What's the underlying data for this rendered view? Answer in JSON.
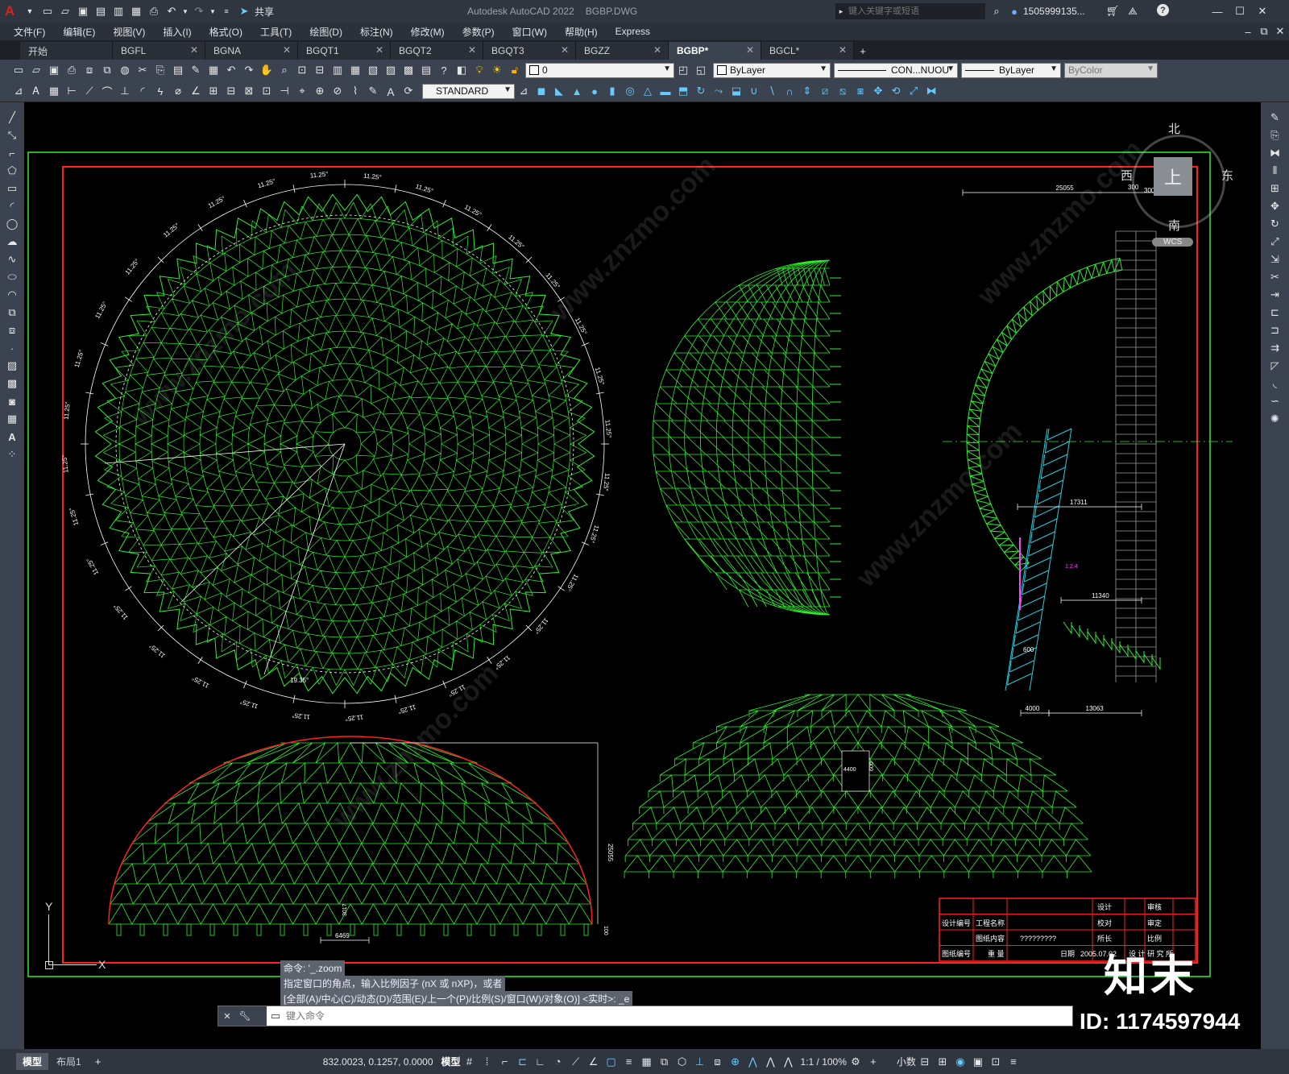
{
  "titlebar": {
    "app_title": "Autodesk AutoCAD 2022",
    "file_title": "BGBP.DWG",
    "share_label": "共享",
    "search_placeholder": "键入关键字或短语",
    "user_label": "1505999135...",
    "app_logo": "A"
  },
  "menu": [
    "文件(F)",
    "编辑(E)",
    "视图(V)",
    "插入(I)",
    "格式(O)",
    "工具(T)",
    "绘图(D)",
    "标注(N)",
    "修改(M)",
    "参数(P)",
    "窗口(W)",
    "帮助(H)",
    "Express"
  ],
  "tabs": [
    {
      "label": "开始",
      "closable": false,
      "active": false
    },
    {
      "label": "BGFL",
      "closable": true,
      "active": false
    },
    {
      "label": "BGNA",
      "closable": true,
      "active": false
    },
    {
      "label": "BGQT1",
      "closable": true,
      "active": false
    },
    {
      "label": "BGQT2",
      "closable": true,
      "active": false
    },
    {
      "label": "BGQT3",
      "closable": true,
      "active": false
    },
    {
      "label": "BGZZ",
      "closable": true,
      "active": false
    },
    {
      "label": "BGBP*",
      "closable": true,
      "active": true
    },
    {
      "label": "BGCL*",
      "closable": true,
      "active": false
    }
  ],
  "toolbar": {
    "layer_value": "0",
    "color_value": "ByLayer",
    "linetype_value": "CON...NUOU",
    "lineweight_value": "ByLayer",
    "plotstyle_value": "ByColor",
    "textstyle_value": "STANDARD"
  },
  "viewcube": {
    "north": "北",
    "south": "南",
    "east": "东",
    "west": "西",
    "face": "上",
    "wcs": "WCS"
  },
  "drawing": {
    "angle_label": "11.25°",
    "special_angle": "19.35°",
    "dims": {
      "plan_width": "25055",
      "plan_small1": "300",
      "plan_small2": "3000",
      "span_a": "17311",
      "span_b": "11340",
      "span_c": "4000",
      "span_d": "13063",
      "small_600": "600",
      "height": "25055",
      "door_w": "6469",
      "door_h": "3017",
      "skylight_w": "4400",
      "skylight_h": "600",
      "base_100": "100",
      "slope": "1:2.4"
    },
    "ucs_y": "Y",
    "ucs_x": "X"
  },
  "titleblock": {
    "design": "设计",
    "review": "审核",
    "check": "校对",
    "approve": "审定",
    "director": "所长",
    "scale": "比例",
    "project_no": "设计编号",
    "project_name": "工程名称",
    "drawing_content": "图纸内容",
    "drawing_no": "图纸编号",
    "content_value": "?????????",
    "date_label": "日期",
    "date_value": "2005.07.02",
    "institute": "设 计 研 究 所",
    "sheet": "重 量"
  },
  "command": {
    "history": [
      "命令: '_.zoom",
      "指定窗口的角点，输入比例因子 (nX 或 nXP)，或者",
      "[全部(A)/中心(C)/动态(D)/范围(E)/上一个(P)/比例(S)/窗口(W)/对象(O)] <实时>: _e"
    ],
    "placeholder": "键入命令"
  },
  "status": {
    "layout_tabs": [
      "模型",
      "布局1"
    ],
    "coords": "832.0023, 0.1257, 0.0000",
    "model_label": "模型",
    "scale": "1:1 / 100%",
    "units": "小数"
  },
  "watermark": {
    "brand": "知末",
    "id": "ID: 1174597944",
    "site": "www.znzmo.com"
  },
  "colors": {
    "green": "#2cf02c",
    "red": "#ff2020",
    "cyan": "#20d0e0",
    "white": "#ffffff",
    "magenta": "#ff40ff"
  }
}
